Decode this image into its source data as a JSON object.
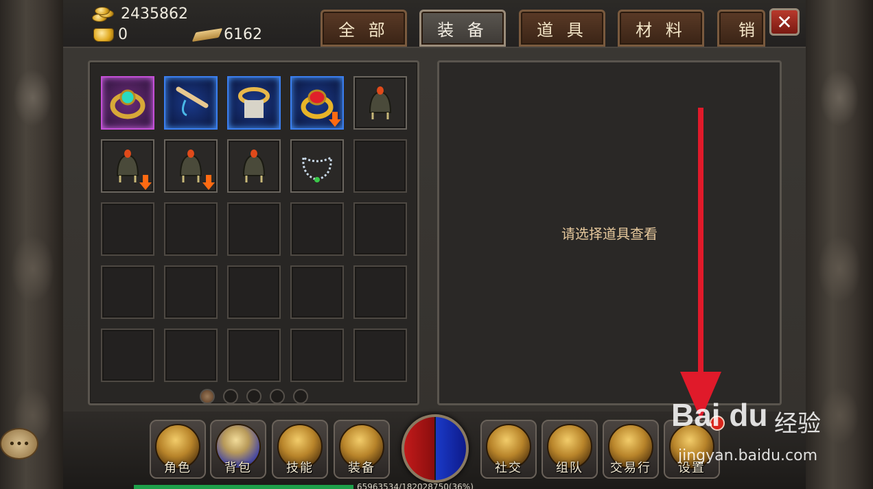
{
  "currencies": {
    "gold": "2435862",
    "ingot": "0",
    "scroll": "6162"
  },
  "tabs": [
    {
      "label": "全 部",
      "active": false
    },
    {
      "label": "装 备",
      "active": true
    },
    {
      "label": "道 具",
      "active": false
    },
    {
      "label": "材 料",
      "active": false
    },
    {
      "label": "销",
      "active": false
    }
  ],
  "close_label": "✕",
  "inventory": {
    "slots": [
      {
        "item": "purple-ring",
        "quality": "purple",
        "downgrade": false
      },
      {
        "item": "flute",
        "quality": "blue",
        "downgrade": false
      },
      {
        "item": "bracelet",
        "quality": "blue",
        "downgrade": false
      },
      {
        "item": "red-gem-ring",
        "quality": "blue",
        "downgrade": true
      },
      {
        "item": "helmet",
        "quality": "normal",
        "downgrade": false
      },
      {
        "item": "helmet",
        "quality": "normal",
        "downgrade": true
      },
      {
        "item": "helmet",
        "quality": "normal",
        "downgrade": true
      },
      {
        "item": "helmet",
        "quality": "normal",
        "downgrade": false
      },
      {
        "item": "necklace",
        "quality": "normal",
        "downgrade": false
      }
    ],
    "total_slots": 25,
    "pages": 5,
    "current_page": 1
  },
  "detail_hint": "请选择道具查看",
  "bottom_nav": [
    {
      "label": "角色",
      "icon": "character-icon"
    },
    {
      "label": "背包",
      "icon": "bag-icon"
    },
    {
      "label": "技能",
      "icon": "skill-book-icon"
    },
    {
      "label": "装备",
      "icon": "equipment-icon"
    },
    {
      "label": "社交",
      "icon": "handshake-icon"
    },
    {
      "label": "组队",
      "icon": "team-flag-icon"
    },
    {
      "label": "交易行",
      "icon": "auction-hammer-icon"
    },
    {
      "label": "设置",
      "icon": "settings-icon"
    }
  ],
  "exp_text": "65963534/182028750(36%)",
  "chat_label": "•••",
  "watermark": {
    "logo": "Bai du",
    "brand": "经验",
    "url": "jingyan.baidu.com"
  },
  "colors": {
    "annotation_arrow": "#e01a2a",
    "purple_quality": "#c54fd8",
    "blue_quality": "#3a7ef0",
    "hint_text": "#e6c89c"
  }
}
